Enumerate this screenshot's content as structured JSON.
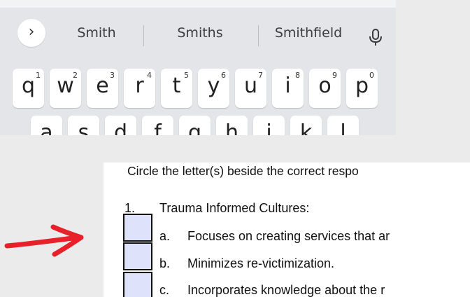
{
  "keyboard": {
    "expand_icon": "chevron-right-icon",
    "suggestions": [
      "Smith",
      "Smiths",
      "Smithfield"
    ],
    "mic_icon": "microphone-icon",
    "row1": [
      {
        "ch": "q",
        "num": "1"
      },
      {
        "ch": "w",
        "num": "2"
      },
      {
        "ch": "e",
        "num": "3"
      },
      {
        "ch": "r",
        "num": "4"
      },
      {
        "ch": "t",
        "num": "5"
      },
      {
        "ch": "y",
        "num": "6"
      },
      {
        "ch": "u",
        "num": "7"
      },
      {
        "ch": "i",
        "num": "8"
      },
      {
        "ch": "o",
        "num": "9"
      },
      {
        "ch": "p",
        "num": "0"
      }
    ],
    "row2": [
      "a",
      "s",
      "d",
      "f",
      "g",
      "h",
      "j",
      "k",
      "l"
    ]
  },
  "document": {
    "instruction": "Circle the letter(s) beside the correct respo",
    "question_number": "1.",
    "question_title": "Trauma Informed Cultures:",
    "options": [
      {
        "letter": "a.",
        "text": "Focuses on creating services that ar"
      },
      {
        "letter": "b.",
        "text": "Minimizes re-victimization."
      },
      {
        "letter": "c.",
        "text": "Incorporates knowledge about the r"
      }
    ]
  },
  "annotation": {
    "arrow_color": "#e8202a"
  }
}
